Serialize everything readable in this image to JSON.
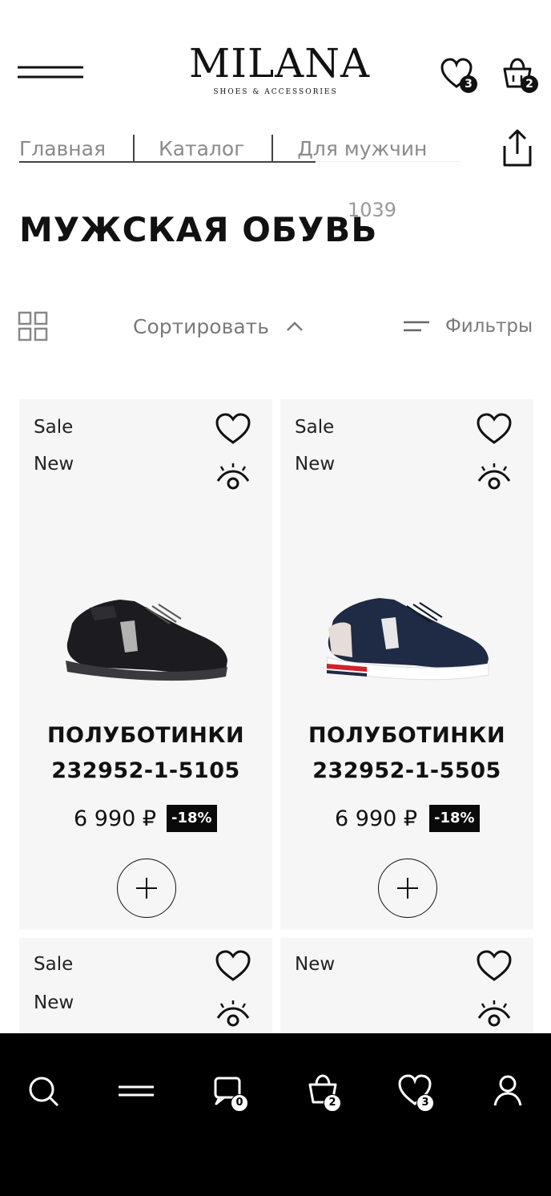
{
  "header": {
    "logo_text": "MILANA",
    "logo_tagline": "SHOES & ACCESSORIES",
    "favorites_count": "3",
    "cart_count": "2"
  },
  "breadcrumbs": [
    "Главная",
    "Каталог",
    "Для мужчин"
  ],
  "page": {
    "title": "МУЖСКАЯ ОБУВЬ",
    "count": "1039"
  },
  "toolbar": {
    "sort_label": "Сортировать",
    "filters_label": "Фильтры"
  },
  "products": [
    {
      "tags": [
        "Sale",
        "New"
      ],
      "name_line1": "ПОЛУБОТИНКИ",
      "name_line2": "232952-1-5105",
      "price": "6 990 ₽",
      "discount": "-18%",
      "color": "black"
    },
    {
      "tags": [
        "Sale",
        "New"
      ],
      "name_line1": "ПОЛУБОТИНКИ",
      "name_line2": "232952-1-5505",
      "price": "6 990 ₽",
      "discount": "-18%",
      "color": "navy"
    },
    {
      "tags": [
        "Sale",
        "New"
      ]
    },
    {
      "tags": [
        "New"
      ]
    }
  ],
  "bottom_nav": {
    "items": [
      "search-icon",
      "menu-icon",
      "chat-icon",
      "cart-icon",
      "heart-icon",
      "user-icon"
    ],
    "chat_count": "0",
    "cart_count": "2",
    "favorites_count": "3"
  },
  "colors": {
    "accent": "#000000",
    "card_bg": "#f6f6f6",
    "muted_text": "#7a7a7a"
  }
}
